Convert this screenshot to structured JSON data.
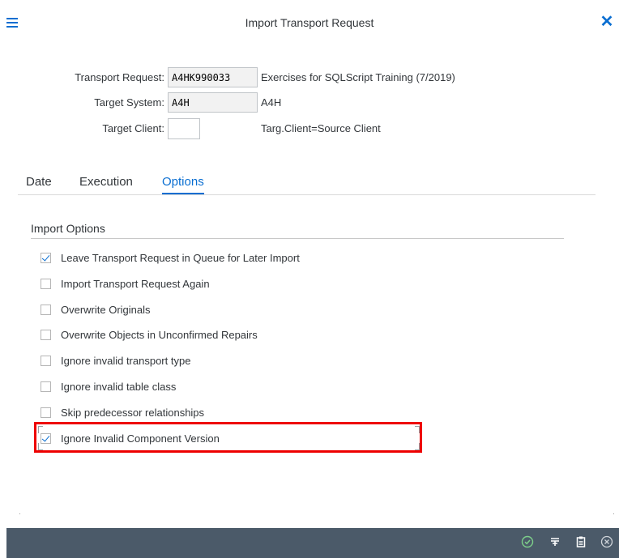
{
  "header": {
    "title": "Import Transport Request"
  },
  "fields": [
    {
      "label": "Transport Request:",
      "value": "A4HK990033",
      "description": "Exercises for SQLScript Training (7/2019)"
    },
    {
      "label": "Target System:",
      "value": "A4H",
      "description": "A4H"
    },
    {
      "label": "Target Client:",
      "value": "",
      "description": "Targ.Client=Source Client"
    }
  ],
  "tabs": [
    {
      "label": "Date"
    },
    {
      "label": "Execution"
    },
    {
      "label": "Options",
      "active": true
    }
  ],
  "section": {
    "title": "Import Options"
  },
  "options": [
    {
      "label": "Leave Transport Request in Queue for Later Import",
      "checked": true
    },
    {
      "label": "Import Transport Request Again",
      "checked": false
    },
    {
      "label": "Overwrite Originals",
      "checked": false
    },
    {
      "label": "Overwrite Objects in Unconfirmed Repairs",
      "checked": false
    },
    {
      "label": "Ignore invalid transport type",
      "checked": false
    },
    {
      "label": "Ignore invalid table class",
      "checked": false
    },
    {
      "label": "Skip predecessor relationships",
      "checked": false
    },
    {
      "label": "Ignore Invalid Component Version",
      "checked": true,
      "highlighted": true
    }
  ],
  "footer": {
    "icons": [
      "checkmark-circle-icon",
      "filter-icon",
      "clipboard-icon",
      "cancel-circle-icon"
    ]
  },
  "colors": {
    "accent": "#0a6ed1",
    "footer_bg": "#4b5a69",
    "highlight": "#ee0000"
  }
}
